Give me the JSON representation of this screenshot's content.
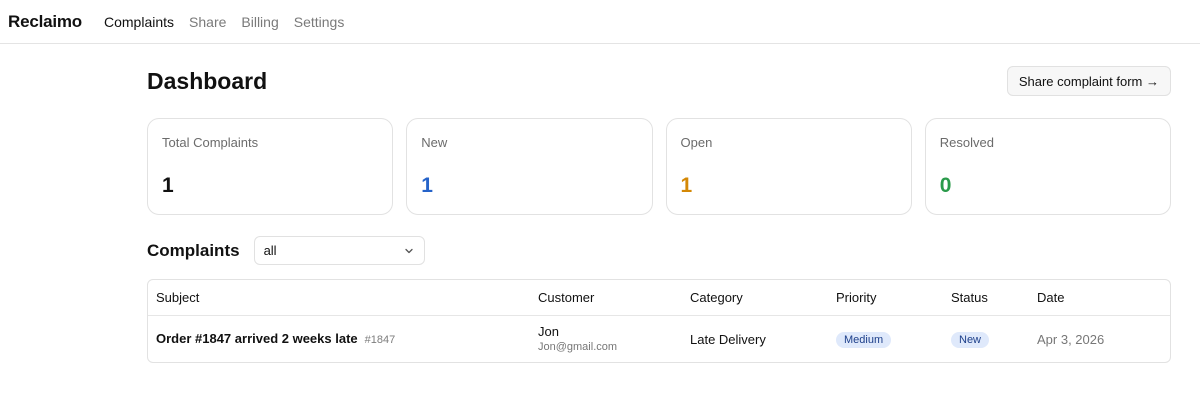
{
  "nav": {
    "brand": "Reclaimo",
    "links": [
      "Complaints",
      "Share",
      "Billing",
      "Settings"
    ]
  },
  "dashboard": {
    "title": "Dashboard",
    "share_button": "Share complaint form →"
  },
  "stats": [
    {
      "label": "Total Complaints",
      "value": "1",
      "color": "#111111"
    },
    {
      "label": "New",
      "value": "1",
      "color": "#2563c9"
    },
    {
      "label": "Open",
      "value": "1",
      "color": "#d48806"
    },
    {
      "label": "Resolved",
      "value": "0",
      "color": "#2a9a4a"
    }
  ],
  "complaints": {
    "title": "Complaints",
    "filter_value": "all",
    "columns": [
      "Subject",
      "Customer",
      "Category",
      "Priority",
      "Status",
      "Date"
    ],
    "rows": [
      {
        "subject": "Order #1847 arrived 2 weeks late",
        "id": "#1847",
        "customer_name": "Jon",
        "customer_email": "Jon@gmail.com",
        "category": "Late Delivery",
        "priority": "Medium",
        "status": "New",
        "date": "Apr 3, 2026"
      }
    ]
  },
  "icons": {
    "filter_chevron": "chevron-down-icon"
  }
}
